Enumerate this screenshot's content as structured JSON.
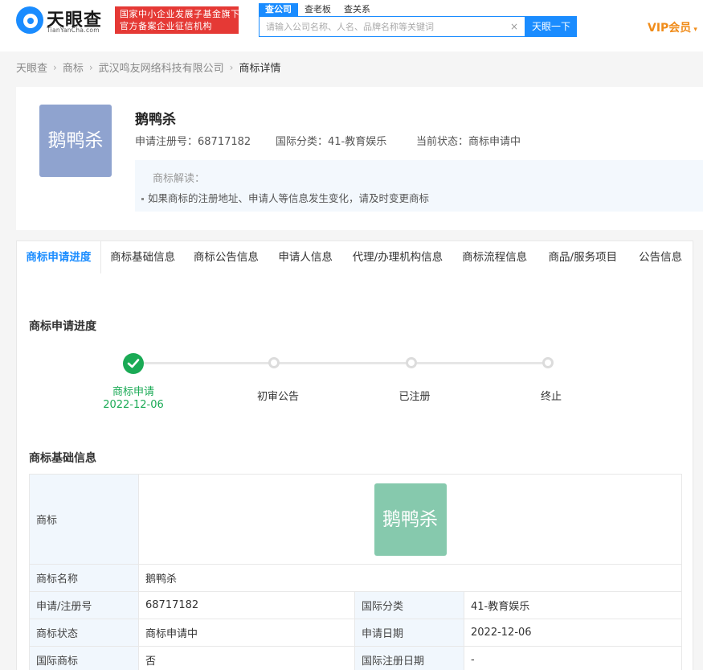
{
  "header": {
    "logo_text": "天眼查",
    "logo_sub": "TianYanCha.com",
    "badge_line1": "国家中小企业发展子基金旗下",
    "badge_line2": "官方备案企业征信机构",
    "search_tabs": [
      "查公司",
      "查老板",
      "查关系"
    ],
    "search_placeholder": "请输入公司名称、人名、品牌名称等关键词",
    "search_clear": "×",
    "search_button": "天眼一下",
    "vip_label": "VIP会员",
    "vip_caret": "▾"
  },
  "breadcrumb": {
    "items": [
      "天眼查",
      "商标",
      "武汉鸣友网络科技有限公司",
      "商标详情"
    ],
    "separator": "›"
  },
  "trademark": {
    "logo_text": "鹅鸭杀",
    "title": "鹅鸭杀",
    "reg_no": "申请注册号：68717182",
    "intl_class": "国际分类：41-教育娱乐",
    "status": "当前状态：商标申请中",
    "note_title": "商标解读：",
    "note_item": "如果商标的注册地址、申请人等信息发生变化，请及时变更商标"
  },
  "tabs": [
    "商标申请进度",
    "商标基础信息",
    "商标公告信息",
    "申请人信息",
    "代理/办理机构信息",
    "商标流程信息",
    "商品/服务项目",
    "公告信息"
  ],
  "progress": {
    "section_title": "商标申请进度",
    "steps": [
      {
        "label": "商标申请",
        "date": "2022-12-06",
        "done": true
      },
      {
        "label": "初审公告",
        "date": "",
        "done": false
      },
      {
        "label": "已注册",
        "date": "",
        "done": false
      },
      {
        "label": "终止",
        "date": "",
        "done": false
      }
    ]
  },
  "basic_info": {
    "section_title": "商标基础信息",
    "rows": [
      {
        "k1": "商标",
        "v1": "鹅鸭杀"
      },
      {
        "k1": "商标名称",
        "v1": "鹅鸭杀"
      },
      {
        "k1": "申请/注册号",
        "v1": "68717182",
        "k2": "国际分类",
        "v2": "41-教育娱乐"
      },
      {
        "k1": "商标状态",
        "v1": "商标申请中",
        "k2": "申请日期",
        "v2": "2022-12-06"
      },
      {
        "k1": "国际商标",
        "v1": "否",
        "k2": "国际注册日期",
        "v2": "-"
      }
    ]
  },
  "colors": {
    "accent": "#1a8cff",
    "success": "#1aaa55",
    "vip": "#f08c1a",
    "badge": "#e53935",
    "tm_logo_blue": "#8fa3cf",
    "tm_logo_green": "#86c9ad"
  }
}
